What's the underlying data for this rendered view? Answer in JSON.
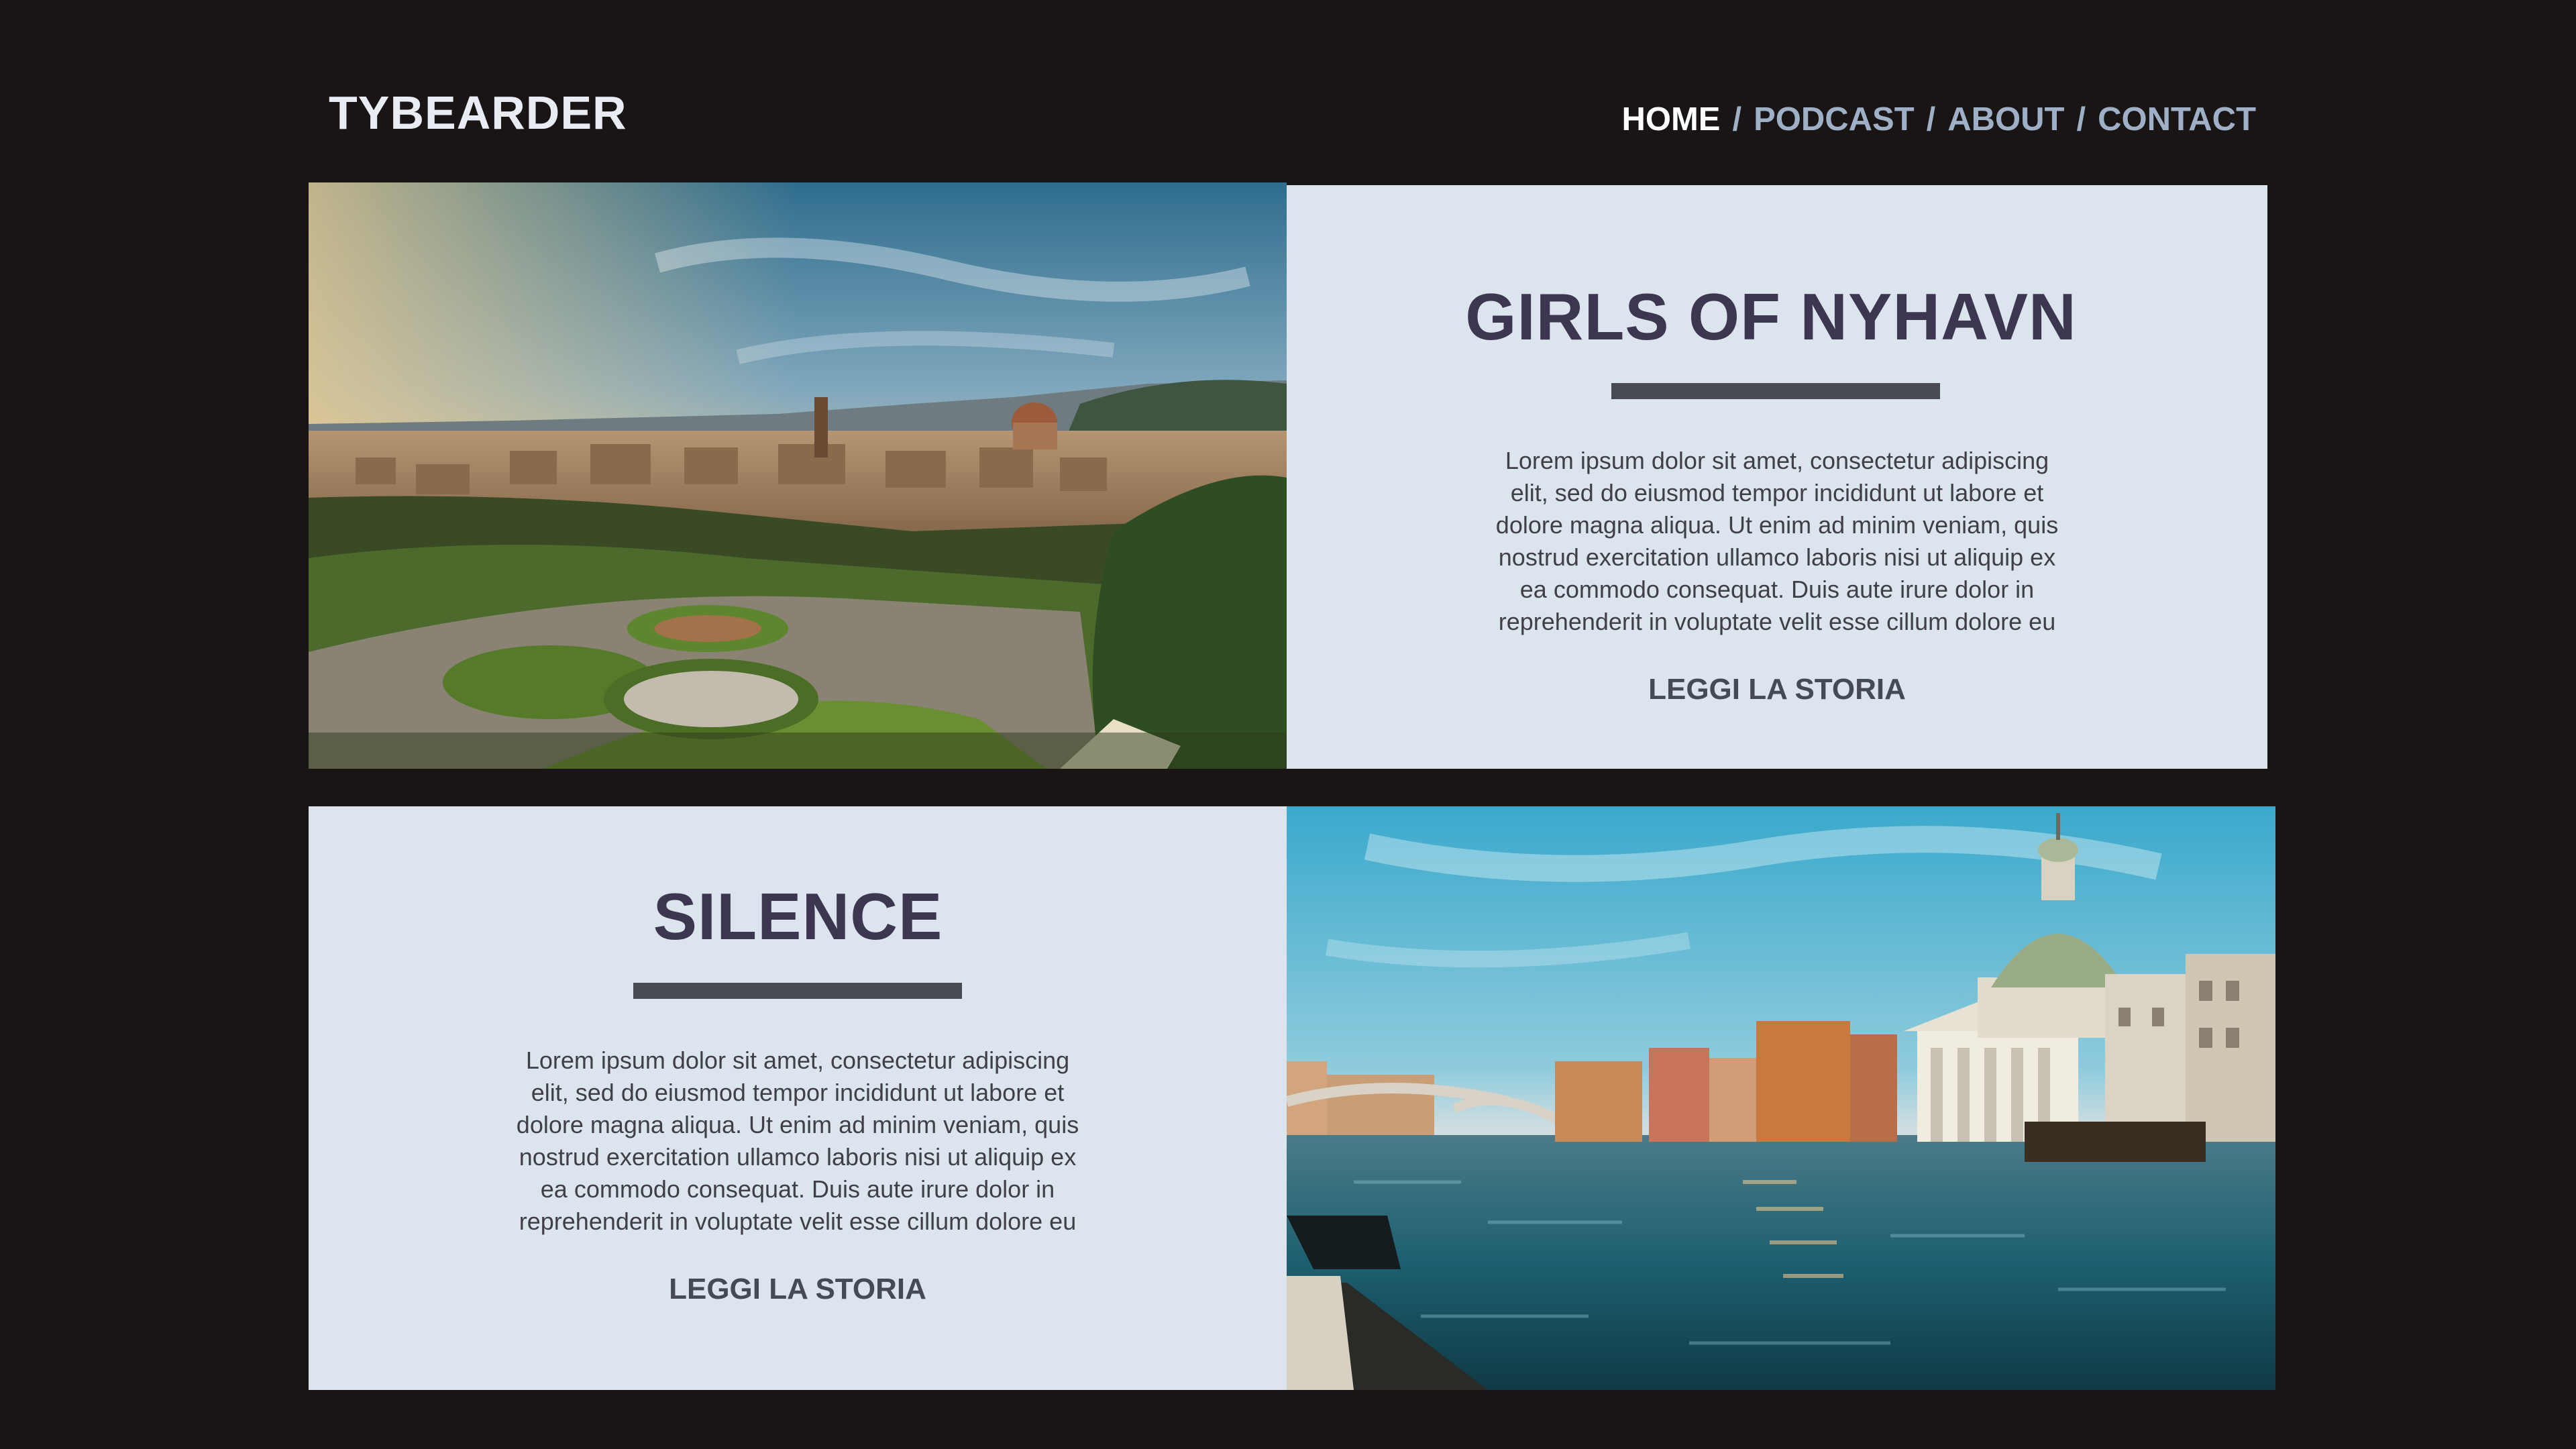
{
  "header": {
    "brand": "TYBEARDER",
    "nav": [
      {
        "label": "HOME",
        "active": true
      },
      {
        "label": "PODCAST",
        "active": false
      },
      {
        "label": "ABOUT",
        "active": false
      },
      {
        "label": "CONTACT",
        "active": false
      }
    ],
    "separator": "/"
  },
  "stories": [
    {
      "title": "GIRLS OF NYHAVN",
      "body": "Lorem ipsum dolor sit amet, consectetur adipiscing elit, sed do eiusmod tempor incididunt ut labore et dolore magna aliqua. Ut enim ad minim veniam, quis nostrud exercitation ullamco laboris nisi ut aliquip ex ea commodo consequat. Duis aute irure dolor in reprehenderit in voluptate velit esse cillum dolore eu",
      "cta": "LEGGI LA STORIA"
    },
    {
      "title": "SILENCE",
      "body": "Lorem ipsum dolor sit amet, consectetur adipiscing elit, sed do eiusmod tempor incididunt ut labore et dolore magna aliqua. Ut enim ad minim veniam, quis nostrud exercitation ullamco laboris nisi ut aliquip ex ea commodo consequat. Duis aute irure dolor in reprehenderit in voluptate velit esse cillum dolore eu",
      "cta": "LEGGI LA STORIA"
    }
  ],
  "colors": {
    "page_bg": "#191515",
    "card_bg": "#dce5ee",
    "title": "#3d3651",
    "rule": "#474a53",
    "nav_active": "#ffffff",
    "nav_inactive": "#9fb0c6"
  }
}
